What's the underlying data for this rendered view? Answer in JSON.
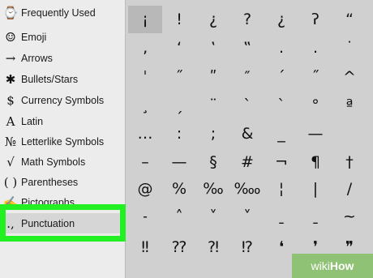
{
  "sidebar": {
    "items": [
      {
        "icon": "clock-icon",
        "glyph": "⌚",
        "label": "Frequently Used"
      },
      {
        "icon": "emoji-icon",
        "glyph": "☺",
        "label": "Emoji"
      },
      {
        "icon": "arrow-icon",
        "glyph": "→",
        "label": "Arrows"
      },
      {
        "icon": "asterisk-icon",
        "glyph": "✱",
        "label": "Bullets/Stars"
      },
      {
        "icon": "dollar-icon",
        "glyph": "$",
        "label": "Currency Symbols"
      },
      {
        "icon": "latin-a-icon",
        "glyph": "A",
        "label": "Latin"
      },
      {
        "icon": "numero-icon",
        "glyph": "№",
        "label": "Letterlike Symbols"
      },
      {
        "icon": "sqrt-icon",
        "glyph": "√",
        "label": "Math Symbols"
      },
      {
        "icon": "parentheses-icon",
        "glyph": "( )",
        "label": "Parentheses"
      },
      {
        "icon": "pictograph-icon",
        "glyph": "✍",
        "label": "Pictographs"
      },
      {
        "icon": "punctuation-icon",
        "glyph": ".,",
        "label": "Punctuation"
      }
    ],
    "selected": "Punctuation"
  },
  "grid": {
    "rows": [
      [
        "¡",
        "!",
        "¿",
        "?",
        "¿",
        "ʔ",
        "“"
      ],
      [
        "‚",
        "‘",
        "‛",
        "‟",
        ".",
        "․",
        "˙"
      ],
      [
        "ˈ",
        "˝",
        "ʺ",
        "″",
        "´",
        "˝",
        "^"
      ],
      [
        "¸",
        "ˏ",
        "¨",
        "`",
        "ˋ",
        "°",
        "ª"
      ],
      [
        "…",
        ":",
        ";",
        "&",
        "_",
        "—",
        ""
      ],
      [
        "–",
        "—",
        "§",
        "#",
        "¬",
        "¶",
        "†"
      ],
      [
        "@",
        "%",
        "‰",
        "‱",
        "¦",
        "|",
        "/"
      ],
      [
        "˗",
        "˄",
        "˅",
        "˅",
        "ˍ",
        "ˍ",
        "~"
      ],
      [
        "‼",
        "⁇",
        "⁈",
        "⁉",
        "❛",
        "❜",
        "❞"
      ]
    ],
    "selected_glyph": "¡"
  },
  "watermark": {
    "part1": "wiki",
    "part2": "How"
  }
}
